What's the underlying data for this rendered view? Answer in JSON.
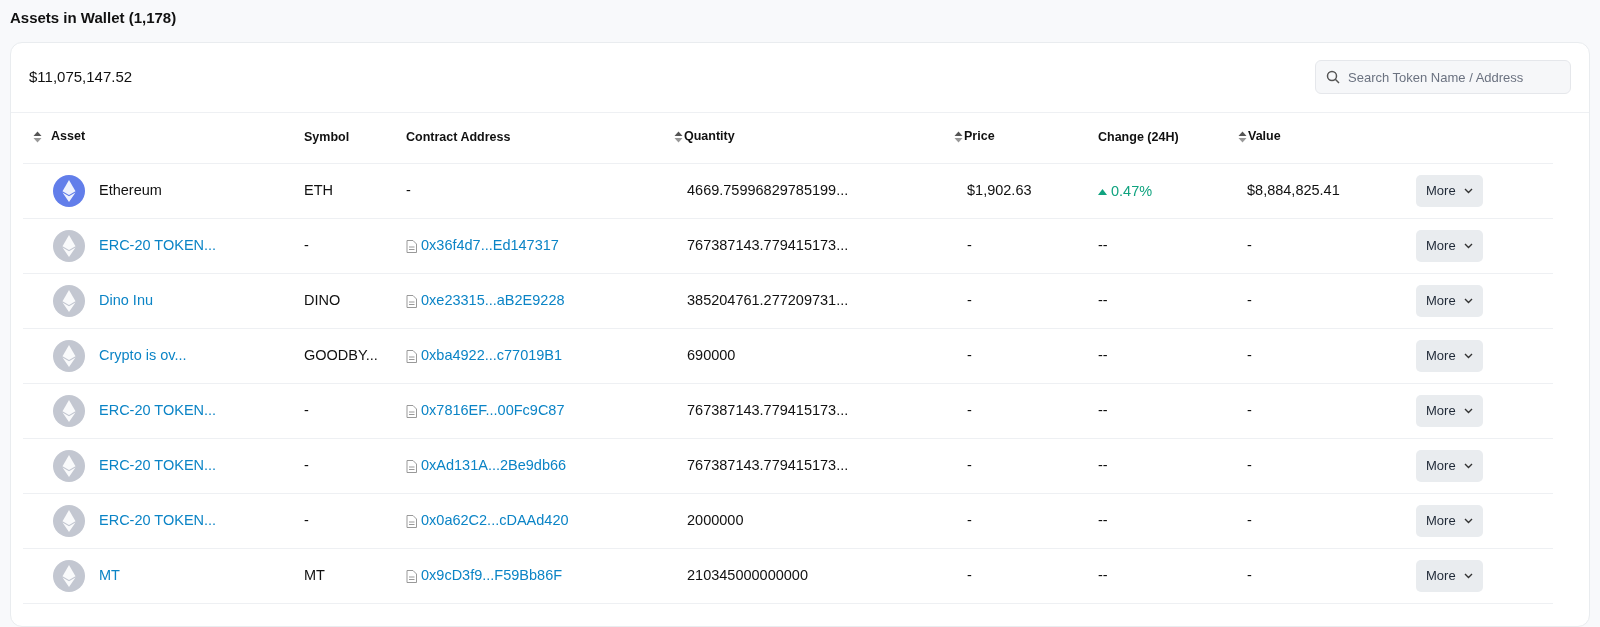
{
  "title": "Assets in Wallet (1,178)",
  "total": "$11,075,147.52",
  "search": {
    "placeholder": "Search Token Name / Address"
  },
  "columns": [
    {
      "label": "Asset",
      "sortable": true
    },
    {
      "label": "Symbol",
      "sortable": false
    },
    {
      "label": "Contract Address",
      "sortable": false
    },
    {
      "label": "Quantity",
      "sortable": true
    },
    {
      "label": "Price",
      "sortable": true
    },
    {
      "label": "Change (24H)",
      "sortable": false
    },
    {
      "label": "Value",
      "sortable": true
    }
  ],
  "rows": [
    {
      "kind": "native",
      "asset": "Ethereum",
      "symbol": "ETH",
      "contract": "-",
      "quantity": "4669.75996829785199...",
      "price": "$1,902.63",
      "change": {
        "text": "0.47%",
        "up": true
      },
      "value": "$8,884,825.41",
      "action": "More"
    },
    {
      "kind": "token",
      "asset": "ERC-20 TOKEN...",
      "symbol": "-",
      "contract": "0x36f4d7...Ed147317",
      "quantity": "767387143.779415173...",
      "price": "-",
      "change": {
        "text": "--",
        "up": false
      },
      "value": "-",
      "action": "More"
    },
    {
      "kind": "token",
      "asset": "Dino Inu",
      "symbol": "DINO",
      "contract": "0xe23315...aB2E9228",
      "quantity": "385204761.277209731...",
      "price": "-",
      "change": {
        "text": "--",
        "up": false
      },
      "value": "-",
      "action": "More"
    },
    {
      "kind": "token",
      "asset": "Crypto is ov...",
      "symbol": "GOODBY...",
      "contract": "0xba4922...c77019B1",
      "quantity": "690000",
      "price": "-",
      "change": {
        "text": "--",
        "up": false
      },
      "value": "-",
      "action": "More"
    },
    {
      "kind": "token",
      "asset": "ERC-20 TOKEN...",
      "symbol": "-",
      "contract": "0x7816EF...00Fc9C87",
      "quantity": "767387143.779415173...",
      "price": "-",
      "change": {
        "text": "--",
        "up": false
      },
      "value": "-",
      "action": "More"
    },
    {
      "kind": "token",
      "asset": "ERC-20 TOKEN...",
      "symbol": "-",
      "contract": "0xAd131A...2Be9db66",
      "quantity": "767387143.779415173...",
      "price": "-",
      "change": {
        "text": "--",
        "up": false
      },
      "value": "-",
      "action": "More"
    },
    {
      "kind": "token",
      "asset": "ERC-20 TOKEN...",
      "symbol": "-",
      "contract": "0x0a62C2...cDAAd420",
      "quantity": "2000000",
      "price": "-",
      "change": {
        "text": "--",
        "up": false
      },
      "value": "-",
      "action": "More"
    },
    {
      "kind": "token",
      "asset": "MT",
      "symbol": "MT",
      "contract": "0x9cD3f9...F59Bb86F",
      "quantity": "210345000000000",
      "price": "-",
      "change": {
        "text": "--",
        "up": false
      },
      "value": "-",
      "action": "More"
    }
  ]
}
